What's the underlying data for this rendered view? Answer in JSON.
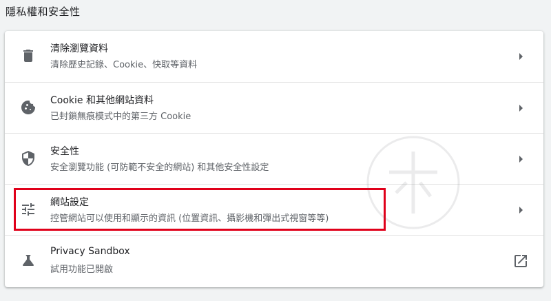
{
  "section": {
    "title": "隱私權和安全性"
  },
  "items": [
    {
      "title": "清除瀏覽資料",
      "subtitle": "清除歷史記錄、Cookie、快取等資料",
      "icon": "trash-icon",
      "action": "chevron-right-icon"
    },
    {
      "title": "Cookie 和其他網站資料",
      "subtitle": "已封鎖無痕模式中的第三方 Cookie",
      "icon": "cookie-icon",
      "action": "chevron-right-icon"
    },
    {
      "title": "安全性",
      "subtitle": "安全瀏覽功能 (可防範不安全的網站) 和其他安全性設定",
      "icon": "shield-icon",
      "action": "chevron-right-icon"
    },
    {
      "title": "網站設定",
      "subtitle": "控管網站可以使用和顯示的資訊 (位置資訊、攝影機和彈出式視窗等等)",
      "icon": "sliders-icon",
      "action": "chevron-right-icon"
    },
    {
      "title": "Privacy Sandbox",
      "subtitle": "試用功能已開啟",
      "icon": "flask-icon",
      "action": "external-link-icon"
    }
  ],
  "colors": {
    "background": "#f1f3f4",
    "card": "#ffffff",
    "highlight": "#e0001a",
    "icon": "#5f6368",
    "secondary_text": "#5f6368"
  }
}
